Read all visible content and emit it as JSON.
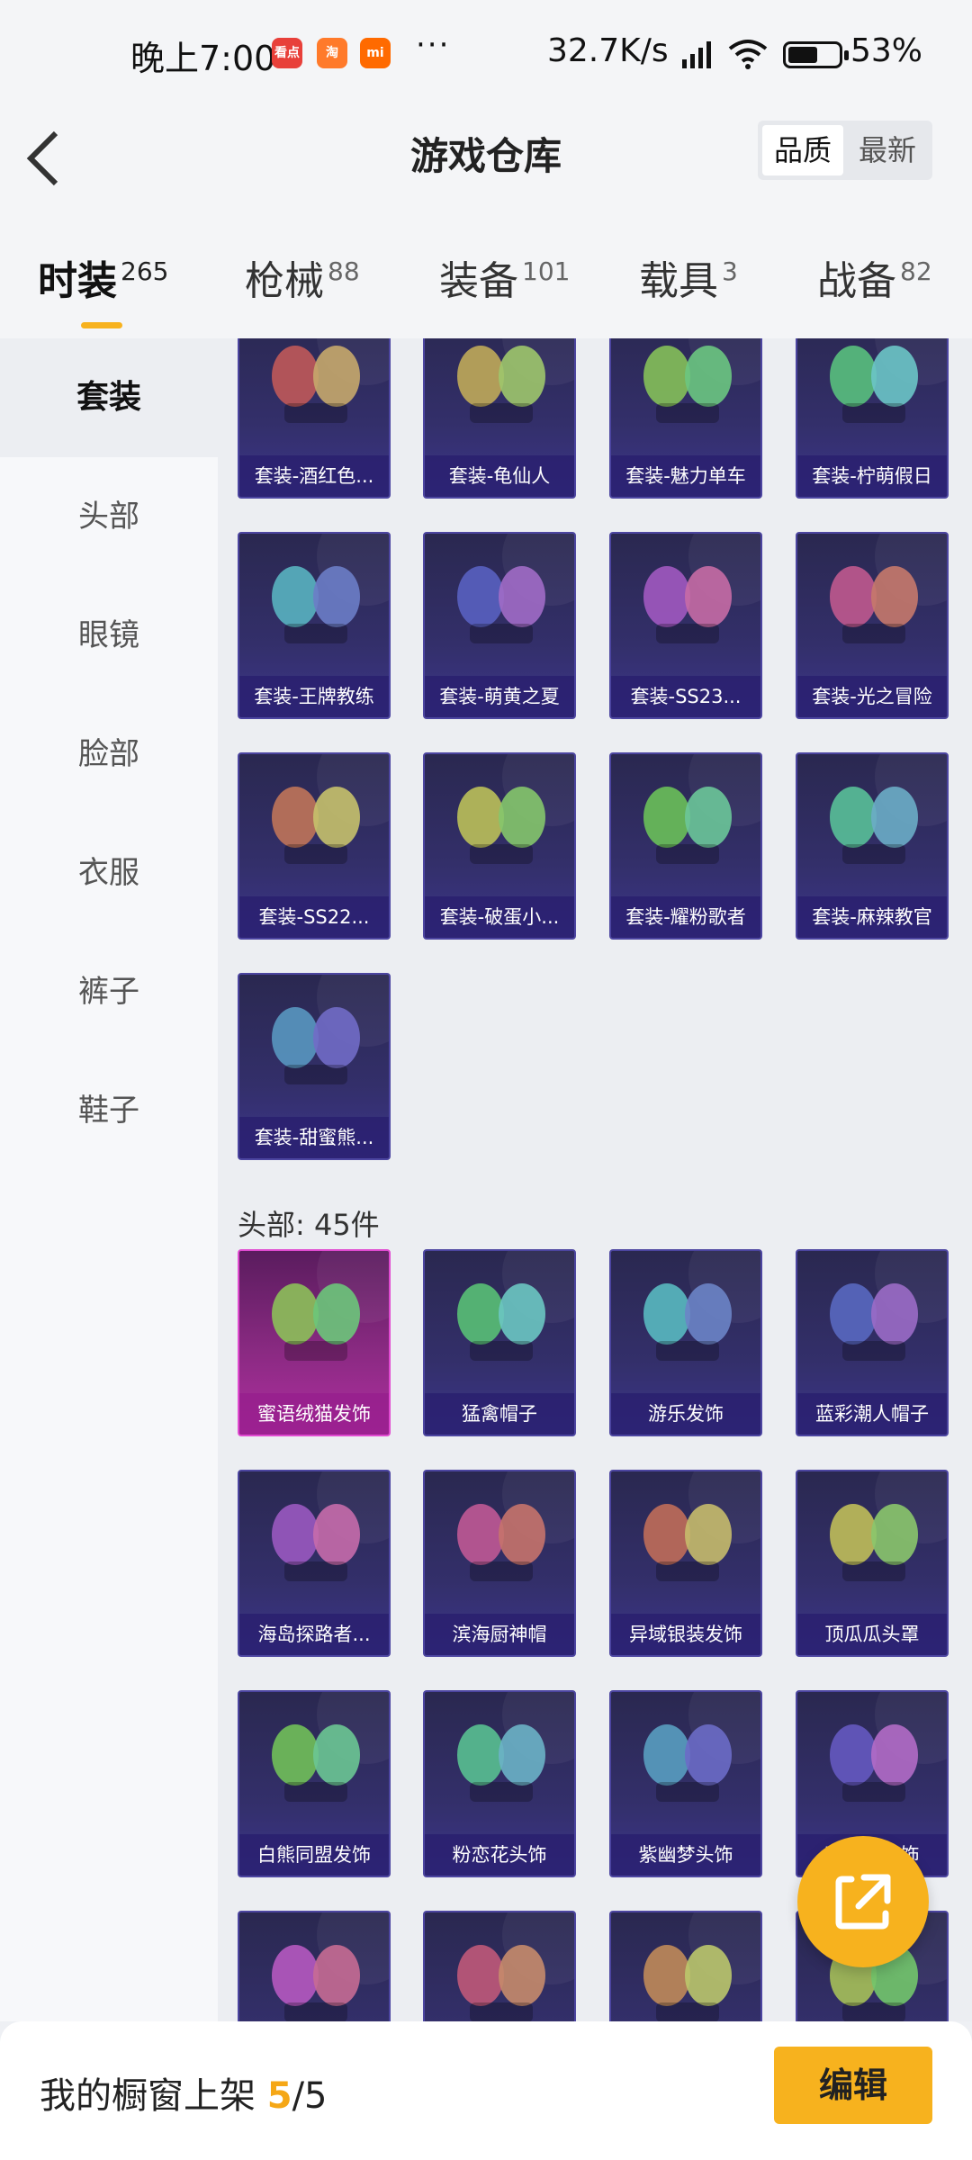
{
  "status_bar": {
    "time": "晚上7:00",
    "app_icons": [
      {
        "name": "kandian-app-icon",
        "label": "看点",
        "color": "#e8403a"
      },
      {
        "name": "taobao-app-icon",
        "label": "淘",
        "color": "#ff7a2a"
      },
      {
        "name": "mi-app-icon",
        "label": "mi",
        "color": "#ff6a00"
      }
    ],
    "more": "···",
    "network_speed": "32.7K/s",
    "battery_percent": "53%",
    "battery_level": 0.53
  },
  "header": {
    "title": "游戏仓库",
    "sort_options": [
      "品质",
      "最新"
    ],
    "active_sort": "品质"
  },
  "tabs": [
    {
      "label": "时装",
      "count": "265",
      "active": true
    },
    {
      "label": "枪械",
      "count": "88",
      "active": false
    },
    {
      "label": "装备",
      "count": "101",
      "active": false
    },
    {
      "label": "载具",
      "count": "3",
      "active": false
    },
    {
      "label": "战备",
      "count": "82",
      "active": false
    }
  ],
  "sidebar": {
    "items": [
      "套装",
      "头部",
      "眼镜",
      "脸部",
      "衣服",
      "裤子",
      "鞋子"
    ],
    "active": "套装"
  },
  "sections": [
    {
      "title": "",
      "items": [
        "套装-酒红色...",
        "套装-龟仙人",
        "套装-魅力单车",
        "套装-柠萌假日",
        "套装-王牌教练",
        "套装-萌黄之夏",
        "套装-SS23...",
        "套装-光之冒险",
        "套装-SS22...",
        "套装-破蛋小...",
        "套装-耀粉歌者",
        "套装-麻辣教官",
        "套装-甜蜜熊..."
      ]
    },
    {
      "title": "头部: 45件",
      "items": [
        "蜜语绒猫发饰",
        "猛禽帽子",
        "游乐发饰",
        "蓝彩潮人帽子",
        "海岛探路者...",
        "滨海厨神帽",
        "异域银装发饰",
        "顶瓜瓜头罩",
        "白熊同盟发饰",
        "粉恋花头饰",
        "紫幽梦头饰",
        "蓝冰羽发饰",
        "",
        "",
        "",
        ""
      ]
    }
  ],
  "bottom_bar": {
    "label": "我的橱窗上架",
    "current": "5",
    "total": "/5",
    "edit_label": "编辑"
  },
  "colors": {
    "accent": "#f7b21e",
    "card_bg": "#332f6a",
    "card_pink": "#b02ea0"
  }
}
